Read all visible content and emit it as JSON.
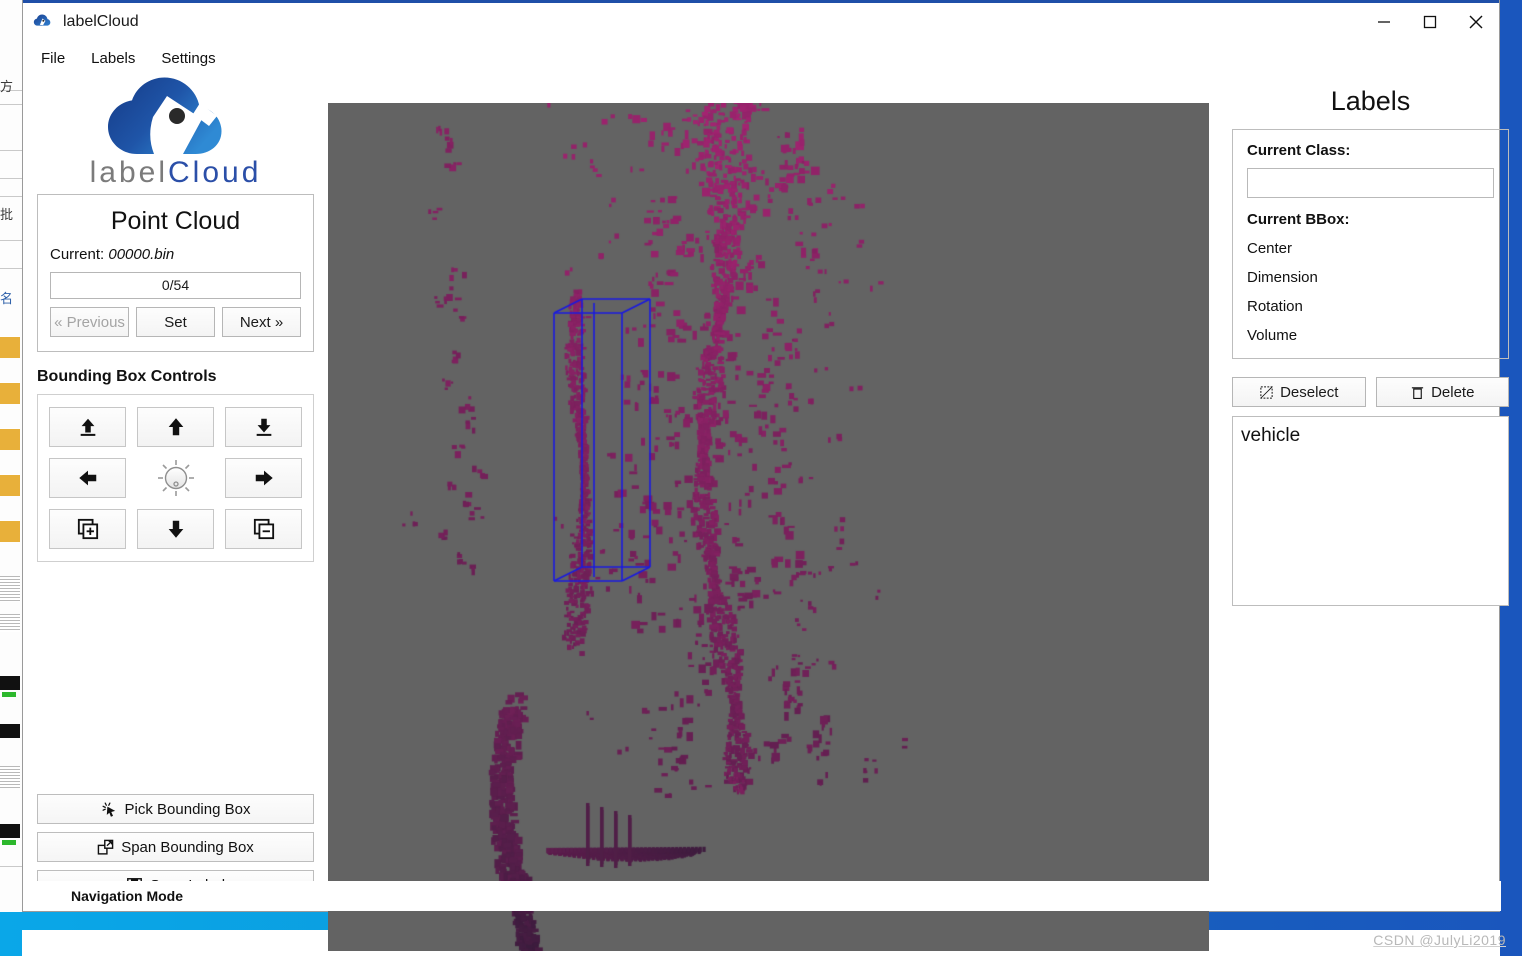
{
  "window": {
    "title": "labelCloud",
    "icon": "cloud-icon",
    "minimize_label": "Minimize",
    "maximize_label": "Maximize",
    "close_label": "Close"
  },
  "menubar": {
    "items": [
      {
        "label": "File"
      },
      {
        "label": "Labels"
      },
      {
        "label": "Settings"
      }
    ]
  },
  "logo": {
    "text_light": "label",
    "text_accent": "Cloud",
    "accent_color": "#2b4fa8",
    "light_color": "#7b7b7b"
  },
  "point_cloud": {
    "title": "Point Cloud",
    "current_label": "Current:",
    "current_file": "00000.bin",
    "progress": "0/54",
    "previous_label": "« Previous",
    "set_label": "Set",
    "next_label": "Next »"
  },
  "bbox_controls": {
    "title": "Bounding Box Controls",
    "buttons": [
      {
        "name": "move-up-z-button",
        "icon": "arrow-up-from-line-icon"
      },
      {
        "name": "move-forward-button",
        "icon": "arrow-up-icon"
      },
      {
        "name": "move-down-z-button",
        "icon": "arrow-down-to-line-icon"
      },
      {
        "name": "move-left-button",
        "icon": "arrow-left-icon"
      },
      {
        "name": "rotate-dial",
        "icon": "rotation-dial-icon"
      },
      {
        "name": "move-right-button",
        "icon": "arrow-right-icon"
      },
      {
        "name": "increase-size-button",
        "icon": "layers-plus-icon"
      },
      {
        "name": "move-backward-button",
        "icon": "arrow-down-icon"
      },
      {
        "name": "decrease-size-button",
        "icon": "layers-minus-icon"
      }
    ]
  },
  "actions": [
    {
      "label": "Pick Bounding Box",
      "icon": "cursor-click-icon",
      "name": "pick-bounding-box-button"
    },
    {
      "label": "Span Bounding Box",
      "icon": "span-box-icon",
      "name": "span-bounding-box-button"
    },
    {
      "label": "Save Label",
      "icon": "floppy-disk-icon",
      "name": "save-label-button"
    }
  ],
  "labels_panel": {
    "title": "Labels",
    "current_class_label": "Current Class:",
    "current_class_value": "",
    "current_class_placeholder": "",
    "current_bbox_label": "Current BBox:",
    "properties": [
      {
        "label": "Center"
      },
      {
        "label": "Dimension"
      },
      {
        "label": "Rotation"
      },
      {
        "label": "Volume"
      }
    ],
    "deselect_label": "Deselect",
    "deselect_icon": "dashed-square-icon",
    "delete_label": "Delete",
    "delete_icon": "trash-icon",
    "label_list": [
      {
        "label": "vehicle"
      }
    ]
  },
  "statusbar": {
    "mode": "Navigation Mode"
  },
  "viewport": {
    "background_color": "#636363",
    "point_color": "#a32470",
    "point_color_dark": "#3a1c3c",
    "bbox_color": "#1a1ae0"
  },
  "watermark": {
    "text": "CSDN @JulyLi2019"
  }
}
